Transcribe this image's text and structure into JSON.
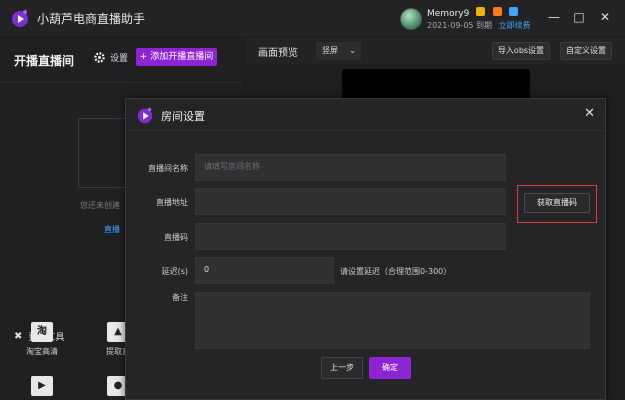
{
  "titlebar": {
    "app_title": "小葫芦电商直播助手",
    "user_name": "Memory9",
    "expiry": "2021-09-05 到期",
    "renew": "立即续费",
    "badge_colors": [
      "#f0b400",
      "#ff7b1c",
      "#3ea6ff"
    ]
  },
  "left": {
    "live_title": "开播直播间",
    "settings": "设置",
    "add_room": "+ 添加开播直播间",
    "empty_text": "您还未创建",
    "empty_link": "直播",
    "more_tools": "更多工具",
    "tools": [
      {
        "label": "淘宝高清",
        "icon": "淘"
      },
      {
        "label": "提取直",
        "icon": "▲"
      },
      {
        "label": "",
        "icon": "▶"
      },
      {
        "label": "",
        "icon": "●"
      }
    ]
  },
  "preview": {
    "label": "画面预览",
    "orientation": "竖屏",
    "import_obs": "导入obs设置",
    "custom": "自定义设置"
  },
  "modal": {
    "title": "房间设置",
    "room_name_label": "直播间名称",
    "room_name_placeholder": "请填写房间名称",
    "address_label": "直播地址",
    "address_value": "",
    "code_label": "直播码",
    "code_value": "",
    "delay_label": "延迟(s)",
    "delay_value": "0",
    "delay_hint": "请设置延迟（合理范围0-300）",
    "note_label": "备注",
    "note_value": "",
    "get_code": "获取直播码",
    "prev": "上一步",
    "ok": "确定"
  },
  "colors": {
    "accent": "#8c24d4",
    "link": "#3ea6ff",
    "highlight": "#e23b3b"
  }
}
